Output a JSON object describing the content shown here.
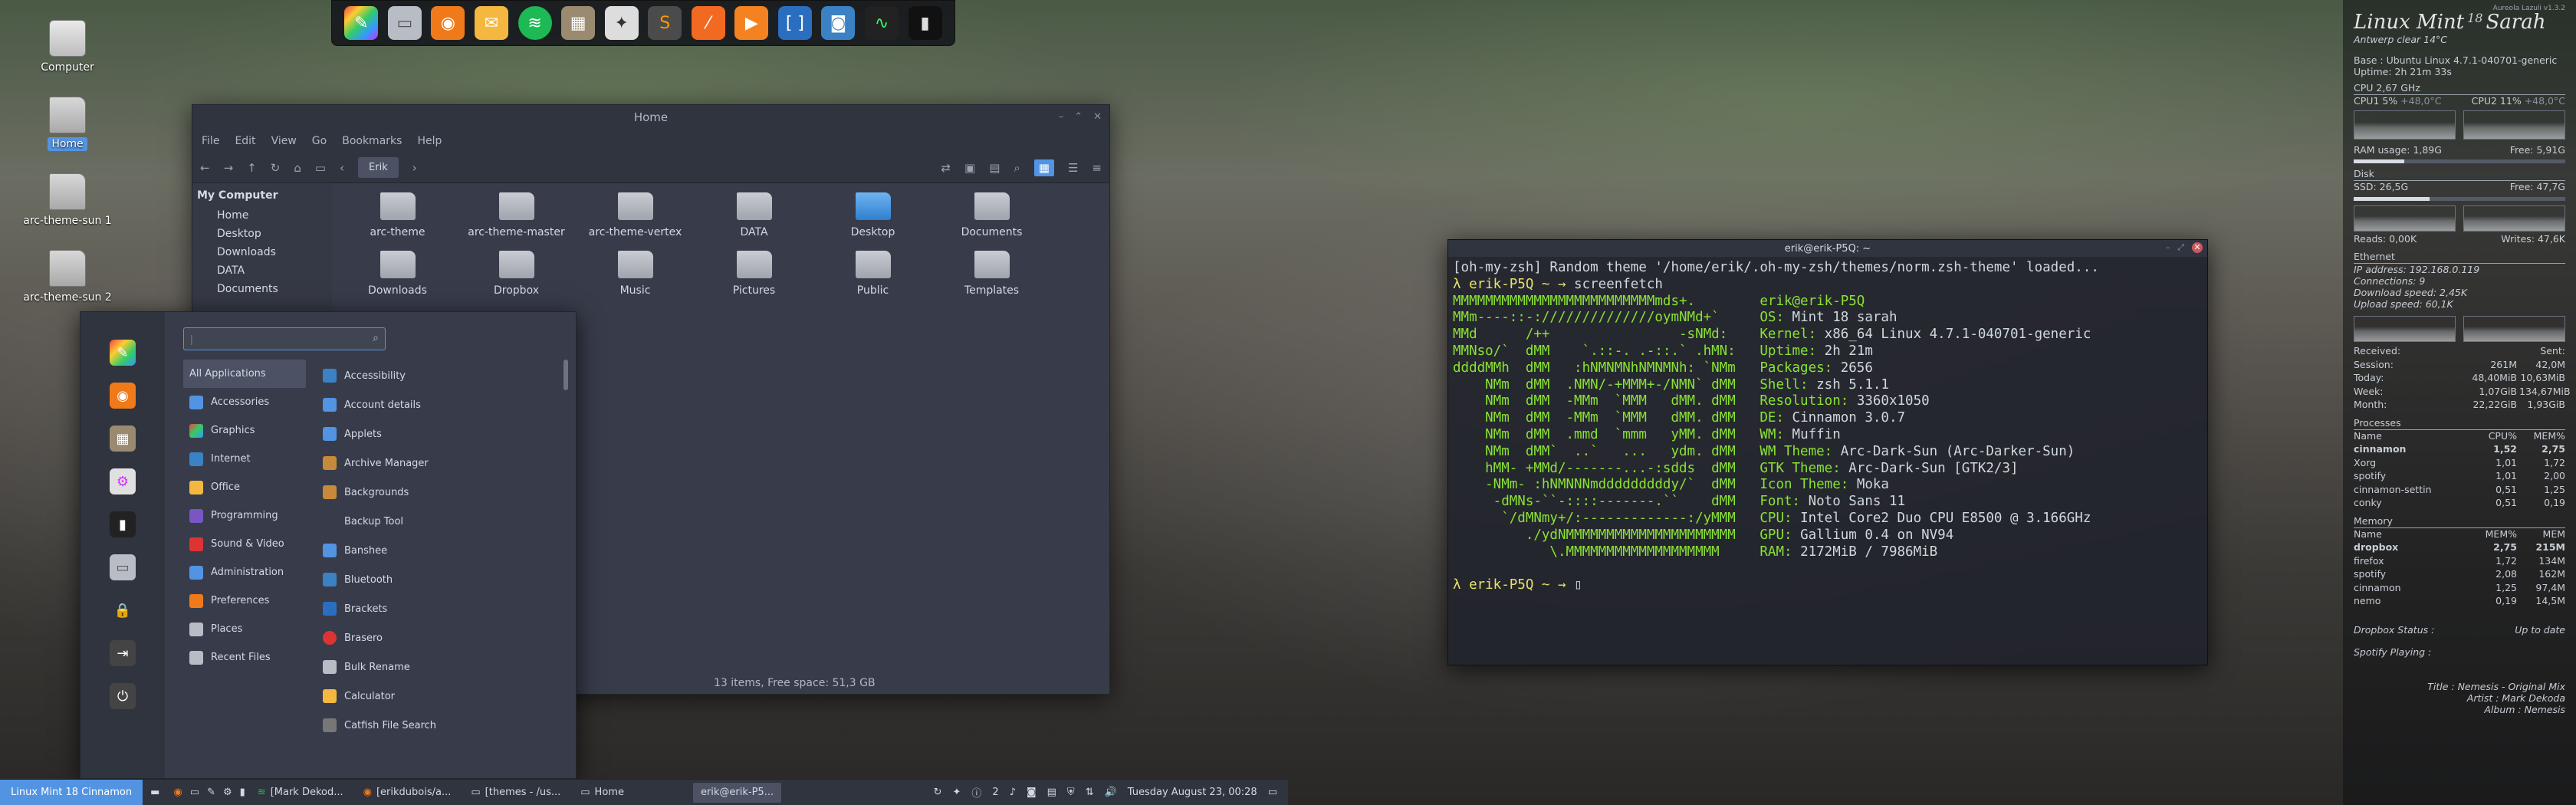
{
  "desktop": {
    "icons": [
      "Computer",
      "Home",
      "arc-theme-sun 1",
      "arc-theme-sun 2"
    ]
  },
  "file_manager": {
    "title": "Home",
    "menu": [
      "File",
      "Edit",
      "View",
      "Go",
      "Bookmarks",
      "Help"
    ],
    "location": "Erik",
    "sidebar_header": "My Computer",
    "sidebar": [
      "Home",
      "Desktop",
      "Downloads",
      "DATA",
      "Documents"
    ],
    "files": [
      "arc-theme",
      "arc-theme-master",
      "arc-theme-vertex",
      "DATA",
      "Desktop",
      "Documents",
      "Downloads",
      "Dropbox",
      "Music",
      "Pictures",
      "Public",
      "Templates"
    ],
    "status": "13 items, Free space: 51,3 GB"
  },
  "menu": {
    "search_placeholder": "|",
    "categories": [
      "All Applications",
      "Accessories",
      "Graphics",
      "Internet",
      "Office",
      "Programming",
      "Sound & Video",
      "Administration",
      "Preferences",
      "Places",
      "Recent Files"
    ],
    "apps": [
      "Accessibility",
      "Account details",
      "Applets",
      "Archive Manager",
      "Backgrounds",
      "Backup Tool",
      "Banshee",
      "Bluetooth",
      "Brackets",
      "Brasero",
      "Bulk Rename",
      "Calculator",
      "Catfish File Search"
    ]
  },
  "panel": {
    "menu_button": "Linux Mint 18 Cinnamon",
    "tasks": [
      "[Mark Dekod...",
      "[erikdubois/a...",
      "[themes - /us...",
      "Home",
      "erik@erik-P5..."
    ],
    "indicator": "2",
    "clock": "Tuesday August 23, 00:28"
  },
  "terminal": {
    "title": "erik@erik-P5Q: ~",
    "line1": "[oh-my-zsh] Random theme '/home/erik/.oh-my-zsh/themes/norm.zsh-theme' loaded...",
    "prompt1": "λ erik-P5Q ~ → ",
    "command": "screenfetch",
    "logo": [
      "MMMMMMMMMMMMMMMMMMMMMMMMMmds+.",
      "MMm----::-://////////////oymNMd+`",
      "MMd      /++                -sNMd:",
      "MMNso/`  dMM    `.::-. .-::.` .hMN:",
      "ddddMMh  dMM   :hNMNMNhNMNMNh: `NMm",
      "    NMm  dMM  .NMN/-+MMM+-/NMN` dMM",
      "    NMm  dMM  -MMm  `MMM   dMM. dMM",
      "    NMm  dMM  -MMm  `MMM   dMM. dMM",
      "    NMm  dMM  .mmd  `mmm   yMM. dMM",
      "    NMm  dMM`  ..`   ...   ydm. dMM",
      "    hMM- +MMd/-------...-:sdds  dMM",
      "    -NMm- :hNMNNNmdddddddddy/`  dMM",
      "     -dMNs-``-::::-------.``    dMM",
      "      `/dMNmy+/:-------------:/yMMM",
      "         ./ydNMMMMMMMMMMMMMMMMMMMMM",
      "            \\.MMMMMMMMMMMMMMMMMMM"
    ],
    "info": [
      [
        "",
        "erik@erik-P5Q"
      ],
      [
        "OS:",
        "Mint 18 sarah"
      ],
      [
        "Kernel:",
        "x86_64 Linux 4.7.1-040701-generic"
      ],
      [
        "Uptime:",
        "2h 21m"
      ],
      [
        "Packages:",
        "2656"
      ],
      [
        "Shell:",
        "zsh 5.1.1"
      ],
      [
        "Resolution:",
        "3360x1050"
      ],
      [
        "DE:",
        "Cinnamon 3.0.7"
      ],
      [
        "WM:",
        "Muffin"
      ],
      [
        "WM Theme:",
        "Arc-Dark-Sun (Arc-Darker-Sun)"
      ],
      [
        "GTK Theme:",
        "Arc-Dark-Sun [GTK2/3]"
      ],
      [
        "Icon Theme:",
        "Moka"
      ],
      [
        "Font:",
        "Noto Sans 11"
      ],
      [
        "CPU:",
        "Intel Core2 Duo CPU E8500 @ 3.166GHz"
      ],
      [
        "GPU:",
        "Gallium 0.4 on NV94"
      ],
      [
        "RAM:",
        "2172MiB / 7986MiB"
      ]
    ],
    "prompt2": "λ erik-P5Q ~ → "
  },
  "conky": {
    "version": "Aureola Lazuli v1.3.2",
    "distro": "Linux Mint",
    "version_num": "18",
    "codename": "Sarah",
    "weather": "Antwerp clear 14°C",
    "base": "Base : Ubuntu Linux 4.7.1-040701-generic",
    "uptime": "Uptime: 2h 21m 33s",
    "cpu_header": "CPU 2,67 GHz",
    "cpu1": "CPU1 5%",
    "cpu1_temp": "+48,0°C",
    "cpu2": "CPU2 11%",
    "cpu2_temp": "+48,0°C",
    "ram_label": "RAM usage: 1,89G",
    "ram_free": "Free: 5,91G",
    "ram_fraction": 0.24,
    "disk_header": "Disk",
    "ssd_label": "SSD: 26,5G",
    "ssd_free": "Free: 47,7G",
    "ssd_fraction": 0.36,
    "reads": "Reads: 0,00K",
    "writes": "Writes: 47,6K",
    "eth_header": "Ethernet",
    "ip": "IP address: 192.168.0.119",
    "connections": "Connections: 9",
    "download": "Download speed: 2,45K",
    "upload": "Upload speed: 60,1K",
    "received": "Received:",
    "sent": "Sent:",
    "traffic": [
      [
        "Session:",
        "261M",
        "42,0M"
      ],
      [
        "Today:",
        "48,40MiB",
        "10,63MiB"
      ],
      [
        "Week:",
        "1,07GiB",
        "134,67MiB"
      ],
      [
        "Month:",
        "22,22GiB",
        "1,93GiB"
      ]
    ],
    "proc_header": "Processes",
    "proc_cols": [
      "Name",
      "CPU%",
      "MEM%"
    ],
    "procs": [
      [
        "cinnamon",
        "1,52",
        "2,75"
      ],
      [
        "Xorg",
        "1,01",
        "1,72"
      ],
      [
        "spotify",
        "1,01",
        "2,00"
      ],
      [
        "cinnamon-settin",
        "0,51",
        "1,25"
      ],
      [
        "conky",
        "0,51",
        "0,19"
      ]
    ],
    "mem_header": "Memory",
    "mem_cols": [
      "Name",
      "MEM%",
      "MEM"
    ],
    "mems": [
      [
        "dropbox",
        "2,75",
        "215M"
      ],
      [
        "firefox",
        "1,72",
        "134M"
      ],
      [
        "spotify",
        "2,08",
        "162M"
      ],
      [
        "cinnamon",
        "1,25",
        "97,4M"
      ],
      [
        "nemo",
        "0,19",
        "14,5M"
      ]
    ],
    "dropbox": "Dropbox Status :",
    "dropbox_val": "Up to date",
    "spotify": "Spotify Playing :",
    "title": "Title : Nemesis - Original Mix",
    "artist": "Artist : Mark Dekoda",
    "album": "Album : Nemesis"
  }
}
